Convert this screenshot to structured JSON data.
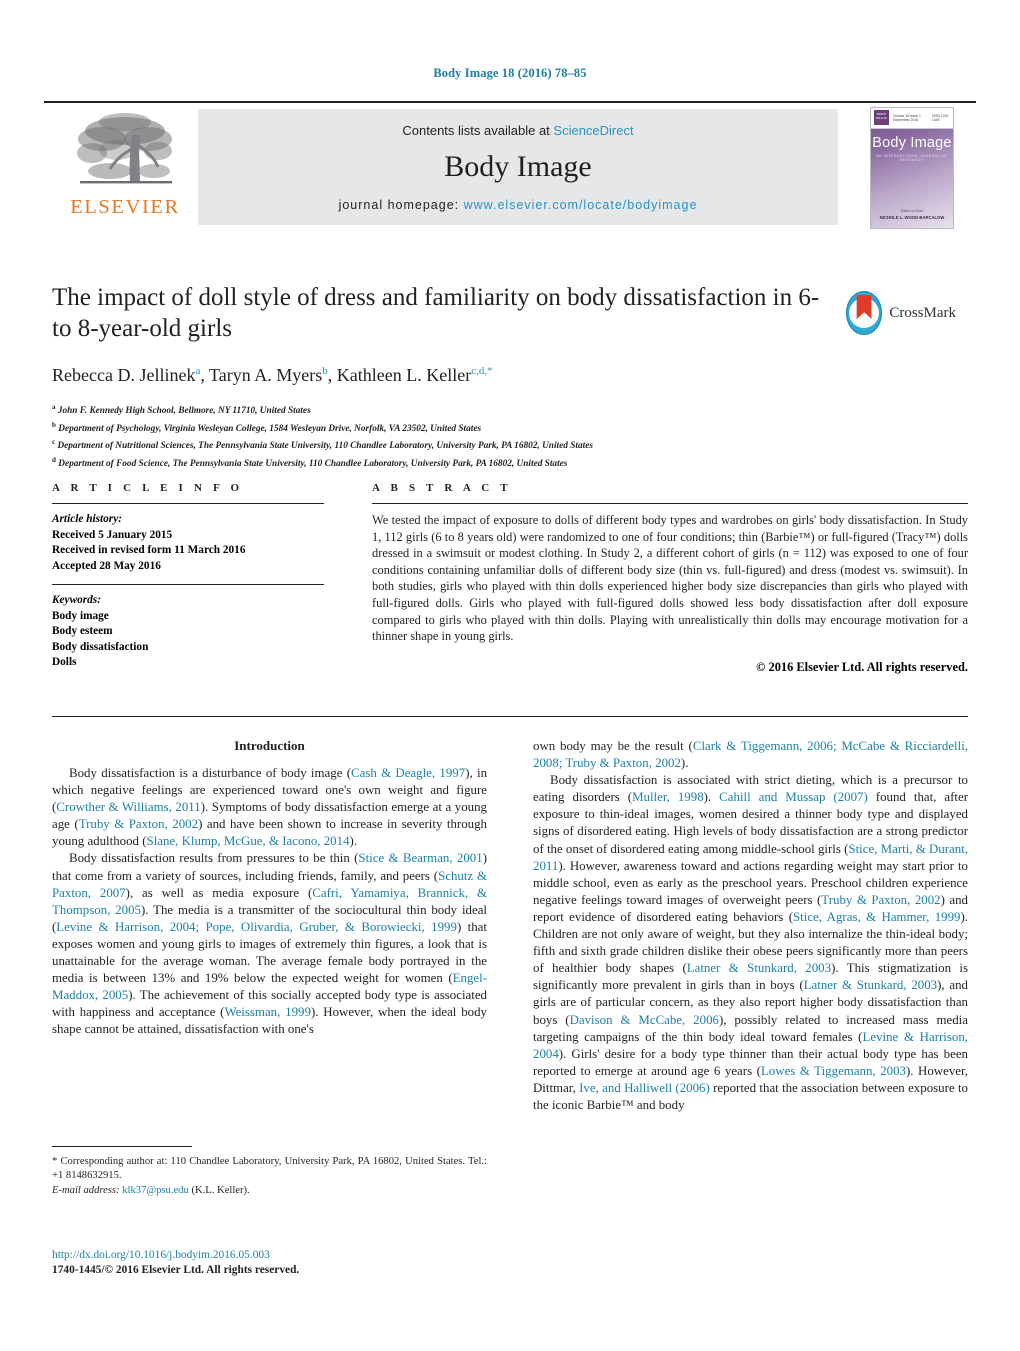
{
  "running_head": "Body Image 18 (2016) 78–85",
  "banner": {
    "contents_prefix": "Contents lists available at ",
    "sciencedirect": "ScienceDirect",
    "journal_title": "Body Image",
    "homepage_label": "journal homepage:",
    "homepage_url": "www.elsevier.com/locate/bodyimage",
    "publisher_logo_text": "ELSEVIER",
    "cover": {
      "title": "Body Image",
      "subtitle": "AN INTERNATIONAL JOURNAL OF RESEARCH",
      "badge_text": "BODY IMAGE",
      "top_left": "Volume 18 Issue 1 September 2016",
      "top_right": "ISSN 1740-1445",
      "editor_label": "Editor-in-Chief",
      "editor_name": "NICHOLE L. WOOD-BARCALOW"
    }
  },
  "crossmark": {
    "label": "CrossMark"
  },
  "article": {
    "title": "The impact of doll style of dress and familiarity on body dissatisfaction in 6- to 8-year-old girls",
    "authors": [
      {
        "name": "Rebecca D. Jellinek",
        "marks": "a",
        "sep": ", "
      },
      {
        "name": "Taryn A. Myers",
        "marks": "b",
        "sep": ", "
      },
      {
        "name": "Kathleen L. Keller",
        "marks": "c,d,*",
        "sep": ""
      }
    ],
    "affiliations": [
      {
        "mark": "a",
        "text": "John F. Kennedy High School, Bellmore, NY 11710, United States"
      },
      {
        "mark": "b",
        "text": "Department of Psychology, Virginia Wesleyan College, 1584 Wesleyan Drive, Norfolk, VA 23502, United States"
      },
      {
        "mark": "c",
        "text": "Department of Nutritional Sciences, The Pennsylvania State University, 110 Chandlee Laboratory, University Park, PA 16802, United States"
      },
      {
        "mark": "d",
        "text": "Department of Food Science, The Pennsylvania State University, 110 Chandlee Laboratory, University Park, PA 16802, United States"
      }
    ]
  },
  "article_info": {
    "heading": "A R T I C L E    I N F O",
    "history_label": "Article history:",
    "history": [
      "Received 5 January 2015",
      "Received in revised form 11 March 2016",
      "Accepted 28 May 2016"
    ],
    "keywords_label": "Keywords:",
    "keywords": [
      "Body image",
      "Body esteem",
      "Body dissatisfaction",
      "Dolls"
    ]
  },
  "abstract": {
    "heading": "A B S T R A C T",
    "text": "We tested the impact of exposure to dolls of different body types and wardrobes on girls' body dissatisfaction. In Study 1, 112 girls (6 to 8 years old) were randomized to one of four conditions; thin (Barbie™) or full-figured (Tracy™) dolls dressed in a swimsuit or modest clothing. In Study 2, a different cohort of girls (n = 112) was exposed to one of four conditions containing unfamiliar dolls of different body size (thin vs. full-figured) and dress (modest vs. swimsuit). In both studies, girls who played with thin dolls experienced higher body size discrepancies than girls who played with full-figured dolls. Girls who played with full-figured dolls showed less body dissatisfaction after doll exposure compared to girls who played with thin dolls. Playing with unrealistically thin dolls may encourage motivation for a thinner shape in young girls.",
    "copyright": "© 2016 Elsevier Ltd. All rights reserved."
  },
  "body": {
    "section_heading": "Introduction",
    "left_paragraphs": [
      "Body dissatisfaction is a disturbance of body image (Cash & Deagle, 1997), in which negative feelings are experienced toward one's own weight and figure (Crowther & Williams, 2011). Symptoms of body dissatisfaction emerge at a young age (Truby & Paxton, 2002) and have been shown to increase in severity through young adulthood (Slane, Klump, McGue, & Iacono, 2014).",
      "Body dissatisfaction results from pressures to be thin (Stice & Bearman, 2001) that come from a variety of sources, including friends, family, and peers (Schutz & Paxton, 2007), as well as media exposure (Cafri, Yamamiya, Brannick, & Thompson, 2005). The media is a transmitter of the sociocultural thin body ideal (Levine & Harrison, 2004; Pope, Olivardia, Gruber, & Borowiecki, 1999) that exposes women and young girls to images of extremely thin figures, a look that is unattainable for the average woman. The average female body portrayed in the media is between 13% and 19% below the expected weight for women (Engel-Maddox, 2005). The achievement of this socially accepted body type is associated with happiness and acceptance (Weissman, 1999). However, when the ideal body shape cannot be attained, dissatisfaction with one's"
    ],
    "right_paragraphs": [
      "own body may be the result (Clark & Tiggemann, 2006; McCabe & Ricciardelli, 2008; Truby & Paxton, 2002).",
      "Body dissatisfaction is associated with strict dieting, which is a precursor to eating disorders (Muller, 1998). Cahill and Mussap (2007) found that, after exposure to thin-ideal images, women desired a thinner body type and displayed signs of disordered eating. High levels of body dissatisfaction are a strong predictor of the onset of disordered eating among middle-school girls (Stice, Marti, & Durant, 2011). However, awareness toward and actions regarding weight may start prior to middle school, even as early as the preschool years. Preschool children experience negative feelings toward images of overweight peers (Truby & Paxton, 2002) and report evidence of disordered eating behaviors (Stice, Agras, & Hammer, 1999). Children are not only aware of weight, but they also internalize the thin-ideal body; fifth and sixth grade children dislike their obese peers significantly more than peers of healthier body shapes (Latner & Stunkard, 2003). This stigmatization is significantly more prevalent in girls than in boys (Latner & Stunkard, 2003), and girls are of particular concern, as they also report higher body dissatisfaction than boys (Davison & McCabe, 2006), possibly related to increased mass media targeting campaigns of the thin body ideal toward females (Levine & Harrison, 2004). Girls' desire for a body type thinner than their actual body type has been reported to emerge at around age 6 years (Lowes & Tiggemann, 2003). However, Dittmar, Ive, and Halliwell (2006) reported that the association between exposure to the iconic Barbie™ and body"
    ]
  },
  "footnote": {
    "corresponding": "* Corresponding author at: 110 Chandlee Laboratory, University Park, PA 16802, United States. Tel.: +1 8148632915.",
    "email_label": "E-mail address:",
    "email": "klk37@psu.edu",
    "email_suffix": "(K.L. Keller)."
  },
  "footer": {
    "doi": "http://dx.doi.org/10.1016/j.bodyim.2016.05.003",
    "issn": "1740-1445/© 2016 Elsevier Ltd. All rights reserved."
  },
  "colors": {
    "link": "#1b7fa8",
    "sciencedirect": "#2b93c4",
    "elsevier_orange": "#e87722",
    "crossmark_blue": "#2fa8d8",
    "crossmark_red": "#e03a28"
  }
}
